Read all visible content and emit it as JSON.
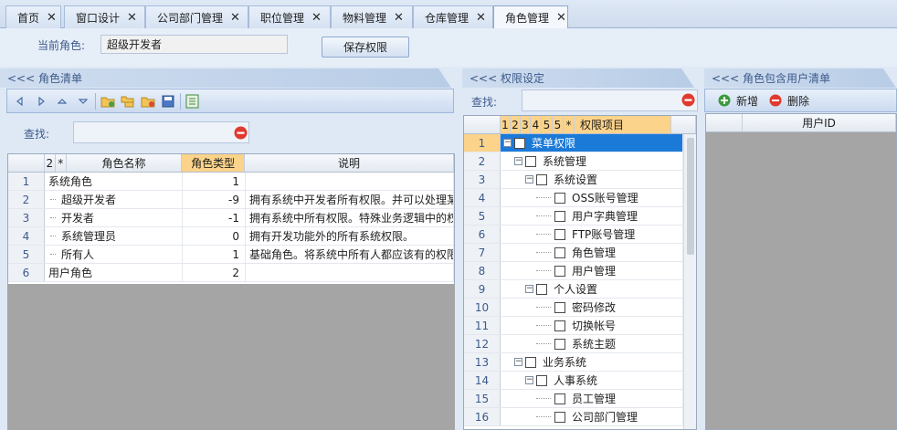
{
  "tabs": [
    {
      "label": "首页"
    },
    {
      "label": "窗口设计"
    },
    {
      "label": "公司部门管理"
    },
    {
      "label": "职位管理"
    },
    {
      "label": "物料管理"
    },
    {
      "label": "仓库管理"
    },
    {
      "label": "角色管理"
    }
  ],
  "close_glyph": "✕",
  "top": {
    "current_role_label": "当前角色:",
    "current_role_value": "超级开发者",
    "save_button": "保存权限"
  },
  "role_panel": {
    "title": "<<< 角色清单",
    "search_label": "查找:",
    "columns": {
      "sort": "2",
      "star": "*",
      "name": "角色名称",
      "type": "角色类型",
      "desc": "说明"
    },
    "rows": [
      {
        "n": "1",
        "name": "系统角色",
        "type": "1",
        "desc": "",
        "child": false
      },
      {
        "n": "2",
        "name": "超级开发者",
        "type": "-9",
        "desc": "拥有系统中开发者所有权限。并可以处理某",
        "child": true
      },
      {
        "n": "3",
        "name": "开发者",
        "type": "-1",
        "desc": "拥有系统中所有权限。特殊业务逻辑中的权",
        "child": true
      },
      {
        "n": "4",
        "name": "系统管理员",
        "type": "0",
        "desc": "拥有开发功能外的所有系统权限。",
        "child": true
      },
      {
        "n": "5",
        "name": "所有人",
        "type": "1",
        "desc": "基础角色。将系统中所有人都应该有的权限",
        "child": true
      },
      {
        "n": "6",
        "name": "用户角色",
        "type": "2",
        "desc": "",
        "child": false
      }
    ]
  },
  "perm_panel": {
    "title": "<<< 权限设定",
    "search_label": "查找:",
    "columns": {
      "c1": "1",
      "c2": "2",
      "c3": "3",
      "c4": "4",
      "c5": "5",
      "c6": "5",
      "star": "*",
      "item": "权限项目"
    },
    "rows": [
      {
        "n": "1",
        "label": "菜单权限",
        "level": 0,
        "expander": "−",
        "checked": true,
        "selected": true
      },
      {
        "n": "2",
        "label": "系统管理",
        "level": 1,
        "expander": "−",
        "checked": false
      },
      {
        "n": "3",
        "label": "系统设置",
        "level": 2,
        "expander": "−",
        "checked": false
      },
      {
        "n": "4",
        "label": "OSS账号管理",
        "level": 3,
        "expander": "",
        "checked": false
      },
      {
        "n": "5",
        "label": "用户字典管理",
        "level": 3,
        "expander": "",
        "checked": false
      },
      {
        "n": "6",
        "label": "FTP账号管理",
        "level": 3,
        "expander": "",
        "checked": false
      },
      {
        "n": "7",
        "label": "角色管理",
        "level": 3,
        "expander": "",
        "checked": false
      },
      {
        "n": "8",
        "label": "用户管理",
        "level": 3,
        "expander": "",
        "checked": false
      },
      {
        "n": "9",
        "label": "个人设置",
        "level": 2,
        "expander": "−",
        "checked": false
      },
      {
        "n": "10",
        "label": "密码修改",
        "level": 3,
        "expander": "",
        "checked": false
      },
      {
        "n": "11",
        "label": "切换帐号",
        "level": 3,
        "expander": "",
        "checked": false
      },
      {
        "n": "12",
        "label": "系统主题",
        "level": 3,
        "expander": "",
        "checked": false
      },
      {
        "n": "13",
        "label": "业务系统",
        "level": 1,
        "expander": "−",
        "checked": false
      },
      {
        "n": "14",
        "label": "人事系统",
        "level": 2,
        "expander": "−",
        "checked": false
      },
      {
        "n": "15",
        "label": "员工管理",
        "level": 3,
        "expander": "",
        "checked": false
      },
      {
        "n": "16",
        "label": "公司部门管理",
        "level": 3,
        "expander": "",
        "checked": false
      }
    ],
    "check_glyph": "✓"
  },
  "user_panel": {
    "title": "<<< 角色包含用户清单",
    "add_button": "新增",
    "delete_button": "删除",
    "column_userid": "用户ID"
  },
  "colors": {
    "accent": "#3d5a8a",
    "selected_row": "#1b7ad8",
    "header_highlight": "#fbd38a",
    "clear_icon": "#e03a2f"
  }
}
